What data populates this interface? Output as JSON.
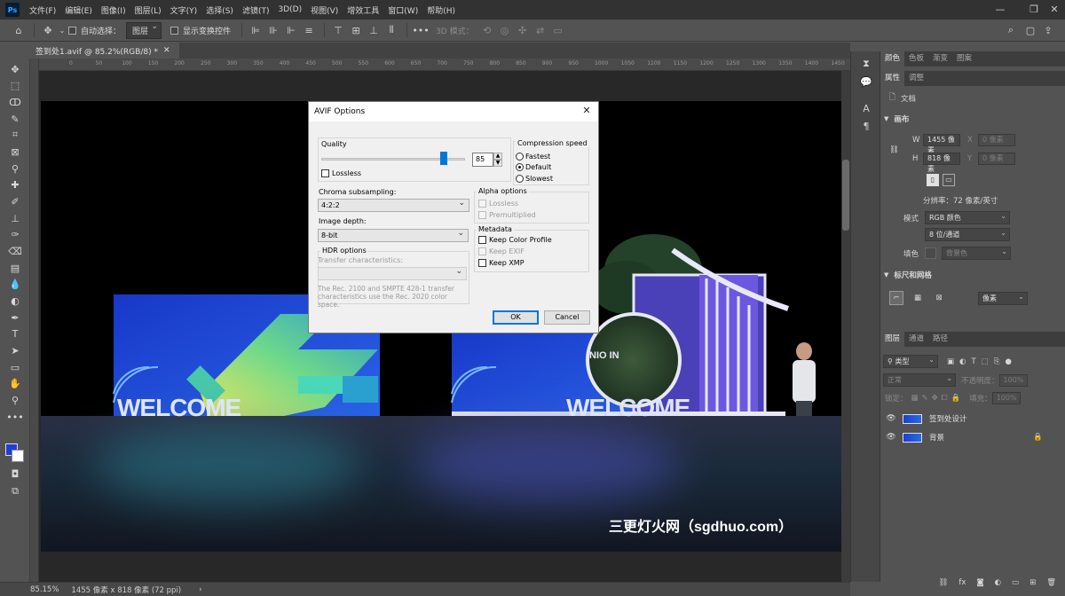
{
  "menubar": {
    "logo": "Ps",
    "items": [
      "文件(F)",
      "编辑(E)",
      "图像(I)",
      "图层(L)",
      "文字(Y)",
      "选择(S)",
      "滤镜(T)",
      "3D(D)",
      "视图(V)",
      "增效工具",
      "窗口(W)",
      "帮助(H)"
    ]
  },
  "options_bar": {
    "auto_select_label": "自动选择：",
    "auto_select_value": "图层",
    "show_transform_label": "显示变换控件",
    "mode_3d_label": "3D 模式："
  },
  "document": {
    "tab_title": "签到处1.avif @ 85.2%(RGB/8) *",
    "ruler_labels": [
      "0",
      "50",
      "100",
      "150",
      "200",
      "250",
      "300",
      "350",
      "400",
      "450",
      "500",
      "550",
      "600",
      "650",
      "700",
      "750",
      "800",
      "850",
      "900",
      "950",
      "1000",
      "1050",
      "1100",
      "1150",
      "1200",
      "1250",
      "1300",
      "1350",
      "1400",
      "1450"
    ]
  },
  "artwork": {
    "welcome_left": "WELCOME",
    "welcome_right": "WELCOME",
    "logo_text": "NIO IN",
    "watermark": "三更灯火网（sgdhuo.com）"
  },
  "status_bar": {
    "zoom": "85.15%",
    "doc_info": "1455 像素 x 818 像素 (72 ppi)"
  },
  "dialog": {
    "title": "AVIF Options",
    "quality_label": "Quality",
    "quality_value": "85",
    "quality_fraction": 0.85,
    "lossless_label": "Lossless",
    "compression_title": "Compression speed",
    "compression_options": [
      "Fastest",
      "Default",
      "Slowest"
    ],
    "compression_selected": "Default",
    "chroma_label": "Chroma subsampling:",
    "chroma_value": "4:2:2",
    "alpha_title": "Alpha options",
    "alpha_lossless": "Lossless",
    "alpha_premultiplied": "Premultiplied",
    "depth_label": "Image depth:",
    "depth_value": "8-bit",
    "metadata_title": "Metadata",
    "keep_color_profile": "Keep Color Profile",
    "keep_exif": "Keep EXIF",
    "keep_xmp": "Keep XMP",
    "hdr_title": "HDR options",
    "transfer_label": "Transfer characteristics:",
    "hdr_note": "The Rec. 2100 and SMPTE 428-1 transfer characteristics use the Rec. 2020 color space.",
    "ok_label": "OK",
    "cancel_label": "Cancel"
  },
  "panels": {
    "top_tabs": [
      "颜色",
      "色板",
      "渐变",
      "图案"
    ],
    "props_tabs": [
      "属性",
      "调整"
    ],
    "doc_label": "文档",
    "canvas_title": "画布",
    "w_label": "W",
    "w_value": "1455 像素",
    "h_label": "H",
    "h_value": "818 像素",
    "x_label": "X",
    "x_value": "0 像素",
    "y_label": "Y",
    "y_value": "0 像素",
    "resolution": "分辨率：72 像素/英寸",
    "mode_label": "模式",
    "mode_value": "RGB 颜色",
    "bit_value": "8 位/通道",
    "fill_label": "填色",
    "fill_value": "背景色",
    "rulers_title": "标尺和网格",
    "unit_value": "像素",
    "layers_tabs": [
      "图层",
      "通道",
      "路径"
    ],
    "kind_filter": "类型",
    "blend_mode": "正常",
    "opacity_label": "不透明度：",
    "opacity_value": "100%",
    "lock_label": "锁定：",
    "fill2_label": "填充：",
    "fill2_value": "100%",
    "layers": [
      {
        "name": "签到处设计",
        "locked": false
      },
      {
        "name": "背景",
        "locked": true
      }
    ]
  },
  "colors": {
    "foreground": "#1c3fd6",
    "background": "#ffffff",
    "accent": "#0078d7"
  }
}
